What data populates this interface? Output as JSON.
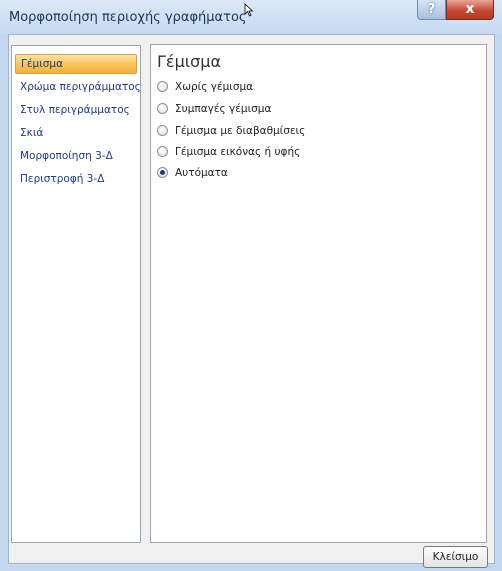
{
  "window": {
    "title": "Μορφοποίηση περιοχής γραφήματος",
    "help_label": "?",
    "close_label": "x"
  },
  "sidebar": {
    "items": [
      {
        "label": "Γέμισμα",
        "active": true
      },
      {
        "label": "Χρώμα περιγράμματος",
        "active": false
      },
      {
        "label": "Στυλ περιγράμματος",
        "active": false
      },
      {
        "label": "Σκιά",
        "active": false
      },
      {
        "label": "Μορφοποίηση 3-Δ",
        "active": false
      },
      {
        "label": "Περιστροφή 3-Δ",
        "active": false
      }
    ]
  },
  "panel": {
    "title": "Γέμισμα",
    "options": [
      {
        "label": "Χωρίς γέμισμα",
        "checked": false
      },
      {
        "label": "Συμπαγές γέμισμα",
        "checked": false
      },
      {
        "label": "Γέμισμα με διαβαθμίσεις",
        "checked": false
      },
      {
        "label": "Γέμισμα εικόνας ή υφής",
        "checked": false
      },
      {
        "label": "Αυτόματα",
        "checked": true
      }
    ]
  },
  "footer": {
    "close_label": "Κλείσιμο"
  },
  "colors": {
    "active_item": "#f9c45c",
    "nav_text": "#1f3a8a",
    "close_button": "#c44a35"
  }
}
